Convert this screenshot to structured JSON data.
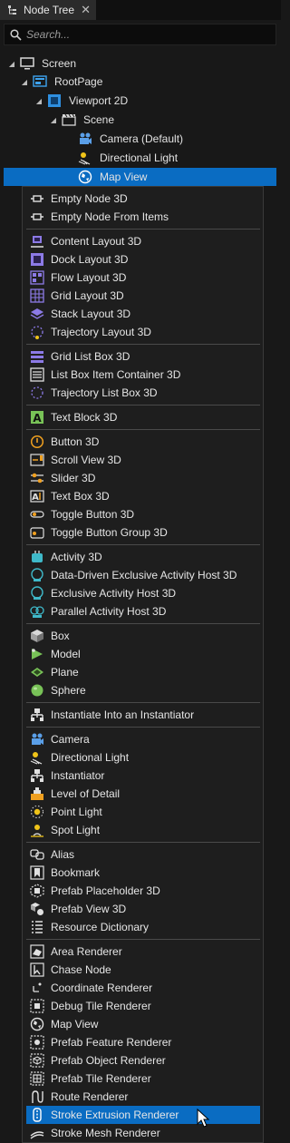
{
  "tab": {
    "label": "Node Tree",
    "close": "✕"
  },
  "search": {
    "placeholder": "Search..."
  },
  "tree": [
    {
      "label": "Screen",
      "icon": "screen-icon"
    },
    {
      "label": "RootPage",
      "icon": "page-icon"
    },
    {
      "label": "Viewport 2D",
      "icon": "viewport-icon"
    },
    {
      "label": "Scene",
      "icon": "scene-icon"
    },
    {
      "label": "Camera (Default)",
      "icon": "camera-icon"
    },
    {
      "label": "Directional Light",
      "icon": "directional-light-icon"
    },
    {
      "label": "Map View",
      "icon": "globe-icon"
    }
  ],
  "menu": {
    "groups": [
      [
        "Empty Node 3D",
        "Empty Node From Items"
      ],
      [
        "Content Layout 3D",
        "Dock Layout 3D",
        "Flow Layout 3D",
        "Grid Layout 3D",
        "Stack Layout 3D",
        "Trajectory Layout 3D"
      ],
      [
        "Grid List Box 3D",
        "List Box Item Container 3D",
        "Trajectory List Box 3D"
      ],
      [
        "Text Block 3D"
      ],
      [
        "Button 3D",
        "Scroll View 3D",
        "Slider 3D",
        "Text Box 3D",
        "Toggle Button 3D",
        "Toggle Button Group 3D"
      ],
      [
        "Activity 3D",
        "Data-Driven Exclusive Activity Host 3D",
        "Exclusive Activity Host 3D",
        "Parallel Activity Host 3D"
      ],
      [
        "Box",
        "Model",
        "Plane",
        "Sphere"
      ],
      [
        "Instantiate Into an Instantiator"
      ],
      [
        "Camera",
        "Directional Light",
        "Instantiator",
        "Level of Detail",
        "Point Light",
        "Spot Light"
      ],
      [
        "Alias",
        "Bookmark",
        "Prefab Placeholder 3D",
        "Prefab View 3D",
        "Resource Dictionary"
      ],
      [
        "Area Renderer",
        "Chase Node",
        "Coordinate Renderer",
        "Debug Tile Renderer",
        "Map View",
        "Prefab Feature Renderer",
        "Prefab Object Renderer",
        "Prefab Tile Renderer",
        "Route Renderer",
        "Stroke Extrusion Renderer",
        "Stroke Mesh Renderer"
      ]
    ],
    "highlighted": "Stroke Extrusion Renderer"
  },
  "colors": {
    "selection": "#0a6cc2",
    "background": "#181818",
    "menu": "#1e1e1e"
  }
}
